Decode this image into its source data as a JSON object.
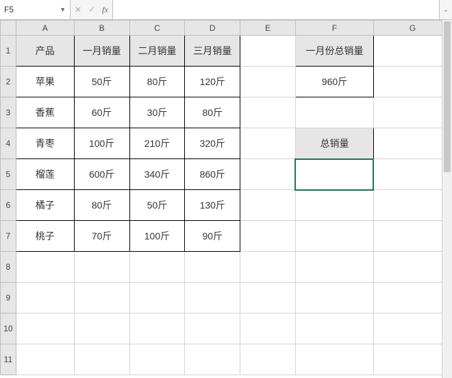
{
  "namebox": {
    "value": "F5"
  },
  "formula": {
    "value": ""
  },
  "columns": [
    "A",
    "B",
    "C",
    "D",
    "E",
    "F",
    "G"
  ],
  "rows": [
    "1",
    "2",
    "3",
    "4",
    "5",
    "6",
    "7",
    "8",
    "9",
    "10",
    "11"
  ],
  "table": {
    "headers": [
      "产品",
      "一月销量",
      "二月销量",
      "三月销量"
    ],
    "rows": [
      {
        "product": "苹果",
        "m1": "50斤",
        "m2": "80斤",
        "m3": "120斤"
      },
      {
        "product": "香蕉",
        "m1": "60斤",
        "m2": "30斤",
        "m3": "80斤"
      },
      {
        "product": "青枣",
        "m1": "100斤",
        "m2": "210斤",
        "m3": "320斤"
      },
      {
        "product": "榴莲",
        "m1": "600斤",
        "m2": "340斤",
        "m3": "860斤"
      },
      {
        "product": "橘子",
        "m1": "80斤",
        "m2": "50斤",
        "m3": "130斤"
      },
      {
        "product": "桃子",
        "m1": "70斤",
        "m2": "100斤",
        "m3": "90斤"
      }
    ]
  },
  "side": {
    "title1": "一月份总销量",
    "total1": "960斤",
    "title2": "总销量",
    "total2": ""
  },
  "active_cell": "F5"
}
